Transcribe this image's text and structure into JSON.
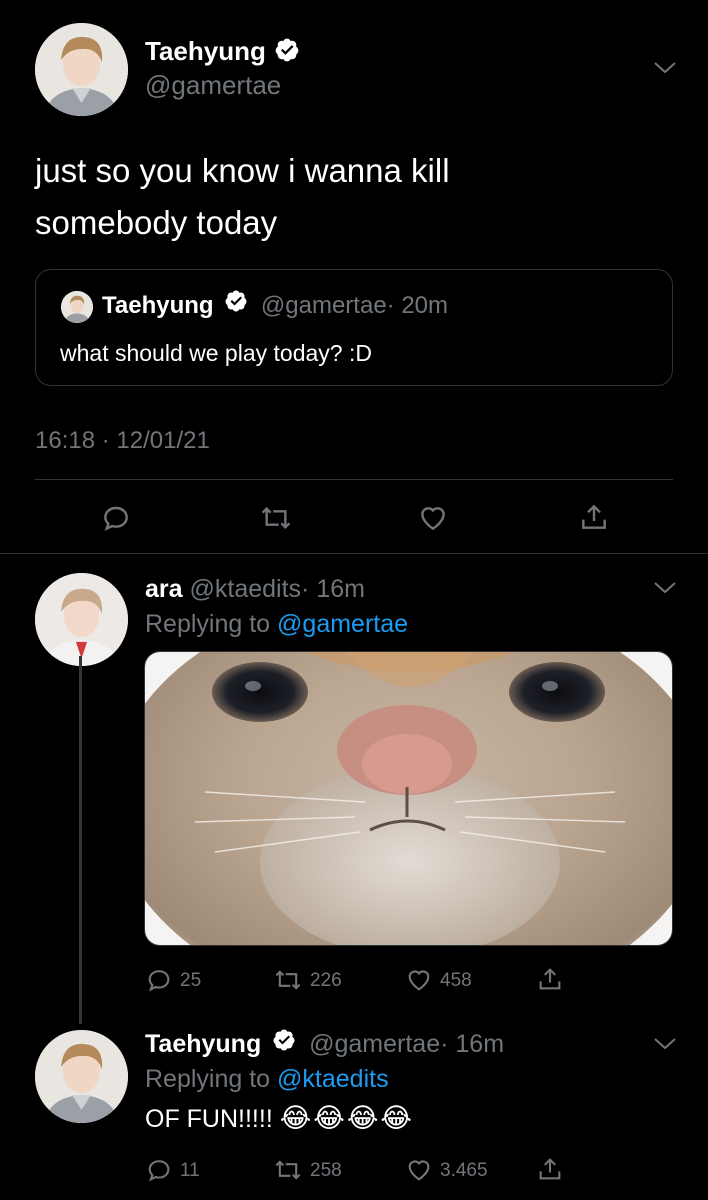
{
  "main_tweet": {
    "name": "Taehyung",
    "handle": "@gamertae",
    "text_line1": "just so you know i wanna kill",
    "text_line2": "somebody today",
    "timestamp": "16:18 · 12/01/21",
    "quote": {
      "name": "Taehyung",
      "handle": "@gamertae",
      "time": "· 20m",
      "text": "what should we play today? :D"
    }
  },
  "reply1": {
    "name": "ara",
    "handle": "@ktaedits",
    "time": "· 16m",
    "replying_prefix": "Replying to ",
    "replying_to": "@gamertae",
    "counts": {
      "replies": "25",
      "retweets": "226",
      "likes": "458"
    }
  },
  "reply2": {
    "name": "Taehyung",
    "handle": "@gamertae",
    "time": "· 16m",
    "replying_prefix": "Replying to ",
    "replying_to": "@ktaedits",
    "text": "OF FUN!!!!!",
    "emoji": "😂😂😂😂",
    "counts": {
      "replies": "11",
      "retweets": "258",
      "likes": "3.465"
    }
  },
  "icons": [
    "verified-badge-icon",
    "chevron-down-icon",
    "reply-icon",
    "retweet-icon",
    "like-icon",
    "share-icon"
  ],
  "colors": {
    "background": "#000000",
    "muted": "#71767b",
    "link": "#1d9bf0",
    "border": "#2f3336"
  }
}
